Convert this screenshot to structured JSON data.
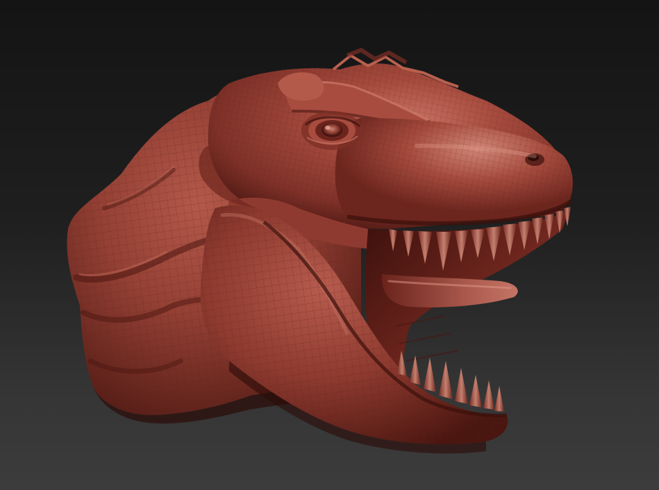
{
  "scene": {
    "subject": "sculpted-tyrannosaurus-head",
    "background_gradient": [
      "#141414",
      "#1e1e1e",
      "#343434",
      "#3d3d3d"
    ],
    "material_colors": {
      "base": "#8f3a30",
      "highlight": "#c06a5c",
      "mid": "#9d4236",
      "shadow": "#4a1712",
      "deep_shadow": "#2b0c09",
      "mouth_interior": "#7a2c24",
      "teeth": "#b8705f",
      "grid_line": "#5f2019"
    }
  }
}
